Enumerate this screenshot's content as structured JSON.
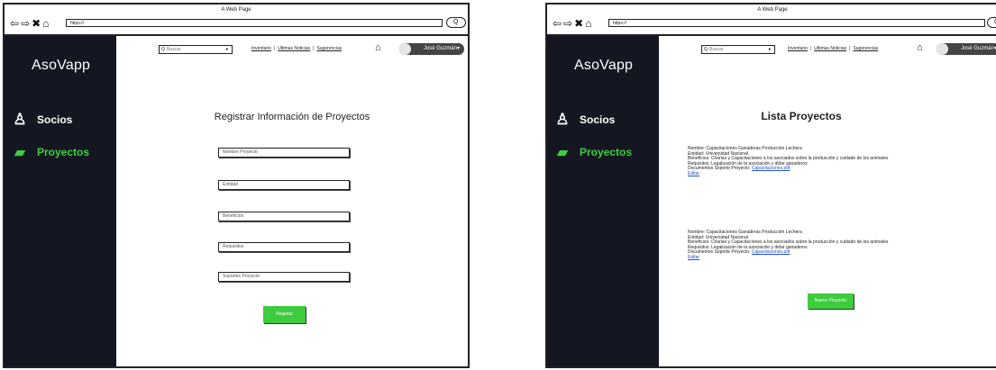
{
  "window_title": "A Web Page",
  "url": "https://",
  "nav_glyphs": {
    "back": "⇦",
    "forward": "⇨",
    "stop": "✖",
    "home": "⌂"
  },
  "url_knob": "Q",
  "brand": "AsoVapp",
  "sidebar": {
    "items": [
      {
        "label": "Socios",
        "icon": "user-icon",
        "glyph": "♙"
      },
      {
        "label": "Proyectos",
        "icon": "book-icon",
        "glyph": "▰"
      }
    ]
  },
  "topbar": {
    "search_placeholder": "Buscar",
    "search_glyph": "Q",
    "mic_glyph": "♦",
    "links": [
      "Inventario",
      "Ultimas Noticias",
      "Sugerencias"
    ],
    "separator": "|",
    "home_glyph": "⌂",
    "user": "José Guzmán▾"
  },
  "register_page": {
    "title": "Registrar Información de Proyectos",
    "fields": [
      "Nombre Proyecto",
      "Entidad",
      "Beneficios",
      "Requisitos",
      "Soportes Proyecto"
    ],
    "submit": "Registar"
  },
  "list_page": {
    "title": "Lista Proyectos",
    "projects": [
      {
        "nombre": "Nombre: Capacitaciones Ganaderas Producción Lechera",
        "entidad": "Entidad: Universidad Nacional",
        "beneficios": "Beneficios: Charlas y Capacitaciones a los asociados sobre la producción y cuidado de los animales",
        "requisitos": "Requisitos: Legalización de la asociación y debe ganaderos",
        "documentos_label": "Documentos Soporte Proyecto:",
        "documentos_link": "Capacitaciones.pdf",
        "edit": "Editar"
      },
      {
        "nombre": "Nombre: Capacitaciones Ganaderas Producción Lechera",
        "entidad": "Entidad: Universidad Nacional",
        "beneficios": "Beneficios: Charlas y Capacitaciones a los asociados sobre la producción y cuidado de los animales",
        "requisitos": "Requisitos: Legalización de la asociación y debe ganaderos",
        "documentos_label": "Documentos Soporte Proyecto:",
        "documentos_link": "Capacitaciones.pdf",
        "edit": "Editar"
      }
    ],
    "new_button": "Nuevo Proyecto"
  },
  "colors": {
    "sidebar": "#141722",
    "accent_green": "#3ecb3e",
    "link_blue": "#2450d6"
  }
}
